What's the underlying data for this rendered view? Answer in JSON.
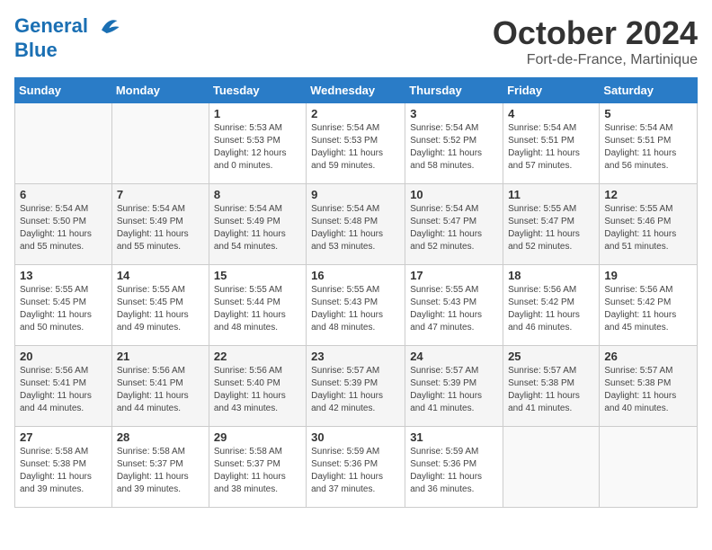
{
  "logo": {
    "line1": "General",
    "line2": "Blue"
  },
  "title": "October 2024",
  "location": "Fort-de-France, Martinique",
  "weekdays": [
    "Sunday",
    "Monday",
    "Tuesday",
    "Wednesday",
    "Thursday",
    "Friday",
    "Saturday"
  ],
  "weeks": [
    [
      {
        "day": "",
        "info": ""
      },
      {
        "day": "",
        "info": ""
      },
      {
        "day": "1",
        "info": "Sunrise: 5:53 AM\nSunset: 5:53 PM\nDaylight: 12 hours and 0 minutes."
      },
      {
        "day": "2",
        "info": "Sunrise: 5:54 AM\nSunset: 5:53 PM\nDaylight: 11 hours and 59 minutes."
      },
      {
        "day": "3",
        "info": "Sunrise: 5:54 AM\nSunset: 5:52 PM\nDaylight: 11 hours and 58 minutes."
      },
      {
        "day": "4",
        "info": "Sunrise: 5:54 AM\nSunset: 5:51 PM\nDaylight: 11 hours and 57 minutes."
      },
      {
        "day": "5",
        "info": "Sunrise: 5:54 AM\nSunset: 5:51 PM\nDaylight: 11 hours and 56 minutes."
      }
    ],
    [
      {
        "day": "6",
        "info": "Sunrise: 5:54 AM\nSunset: 5:50 PM\nDaylight: 11 hours and 55 minutes."
      },
      {
        "day": "7",
        "info": "Sunrise: 5:54 AM\nSunset: 5:49 PM\nDaylight: 11 hours and 55 minutes."
      },
      {
        "day": "8",
        "info": "Sunrise: 5:54 AM\nSunset: 5:49 PM\nDaylight: 11 hours and 54 minutes."
      },
      {
        "day": "9",
        "info": "Sunrise: 5:54 AM\nSunset: 5:48 PM\nDaylight: 11 hours and 53 minutes."
      },
      {
        "day": "10",
        "info": "Sunrise: 5:54 AM\nSunset: 5:47 PM\nDaylight: 11 hours and 52 minutes."
      },
      {
        "day": "11",
        "info": "Sunrise: 5:55 AM\nSunset: 5:47 PM\nDaylight: 11 hours and 52 minutes."
      },
      {
        "day": "12",
        "info": "Sunrise: 5:55 AM\nSunset: 5:46 PM\nDaylight: 11 hours and 51 minutes."
      }
    ],
    [
      {
        "day": "13",
        "info": "Sunrise: 5:55 AM\nSunset: 5:45 PM\nDaylight: 11 hours and 50 minutes."
      },
      {
        "day": "14",
        "info": "Sunrise: 5:55 AM\nSunset: 5:45 PM\nDaylight: 11 hours and 49 minutes."
      },
      {
        "day": "15",
        "info": "Sunrise: 5:55 AM\nSunset: 5:44 PM\nDaylight: 11 hours and 48 minutes."
      },
      {
        "day": "16",
        "info": "Sunrise: 5:55 AM\nSunset: 5:43 PM\nDaylight: 11 hours and 48 minutes."
      },
      {
        "day": "17",
        "info": "Sunrise: 5:55 AM\nSunset: 5:43 PM\nDaylight: 11 hours and 47 minutes."
      },
      {
        "day": "18",
        "info": "Sunrise: 5:56 AM\nSunset: 5:42 PM\nDaylight: 11 hours and 46 minutes."
      },
      {
        "day": "19",
        "info": "Sunrise: 5:56 AM\nSunset: 5:42 PM\nDaylight: 11 hours and 45 minutes."
      }
    ],
    [
      {
        "day": "20",
        "info": "Sunrise: 5:56 AM\nSunset: 5:41 PM\nDaylight: 11 hours and 44 minutes."
      },
      {
        "day": "21",
        "info": "Sunrise: 5:56 AM\nSunset: 5:41 PM\nDaylight: 11 hours and 44 minutes."
      },
      {
        "day": "22",
        "info": "Sunrise: 5:56 AM\nSunset: 5:40 PM\nDaylight: 11 hours and 43 minutes."
      },
      {
        "day": "23",
        "info": "Sunrise: 5:57 AM\nSunset: 5:39 PM\nDaylight: 11 hours and 42 minutes."
      },
      {
        "day": "24",
        "info": "Sunrise: 5:57 AM\nSunset: 5:39 PM\nDaylight: 11 hours and 41 minutes."
      },
      {
        "day": "25",
        "info": "Sunrise: 5:57 AM\nSunset: 5:38 PM\nDaylight: 11 hours and 41 minutes."
      },
      {
        "day": "26",
        "info": "Sunrise: 5:57 AM\nSunset: 5:38 PM\nDaylight: 11 hours and 40 minutes."
      }
    ],
    [
      {
        "day": "27",
        "info": "Sunrise: 5:58 AM\nSunset: 5:38 PM\nDaylight: 11 hours and 39 minutes."
      },
      {
        "day": "28",
        "info": "Sunrise: 5:58 AM\nSunset: 5:37 PM\nDaylight: 11 hours and 39 minutes."
      },
      {
        "day": "29",
        "info": "Sunrise: 5:58 AM\nSunset: 5:37 PM\nDaylight: 11 hours and 38 minutes."
      },
      {
        "day": "30",
        "info": "Sunrise: 5:59 AM\nSunset: 5:36 PM\nDaylight: 11 hours and 37 minutes."
      },
      {
        "day": "31",
        "info": "Sunrise: 5:59 AM\nSunset: 5:36 PM\nDaylight: 11 hours and 36 minutes."
      },
      {
        "day": "",
        "info": ""
      },
      {
        "day": "",
        "info": ""
      }
    ]
  ]
}
